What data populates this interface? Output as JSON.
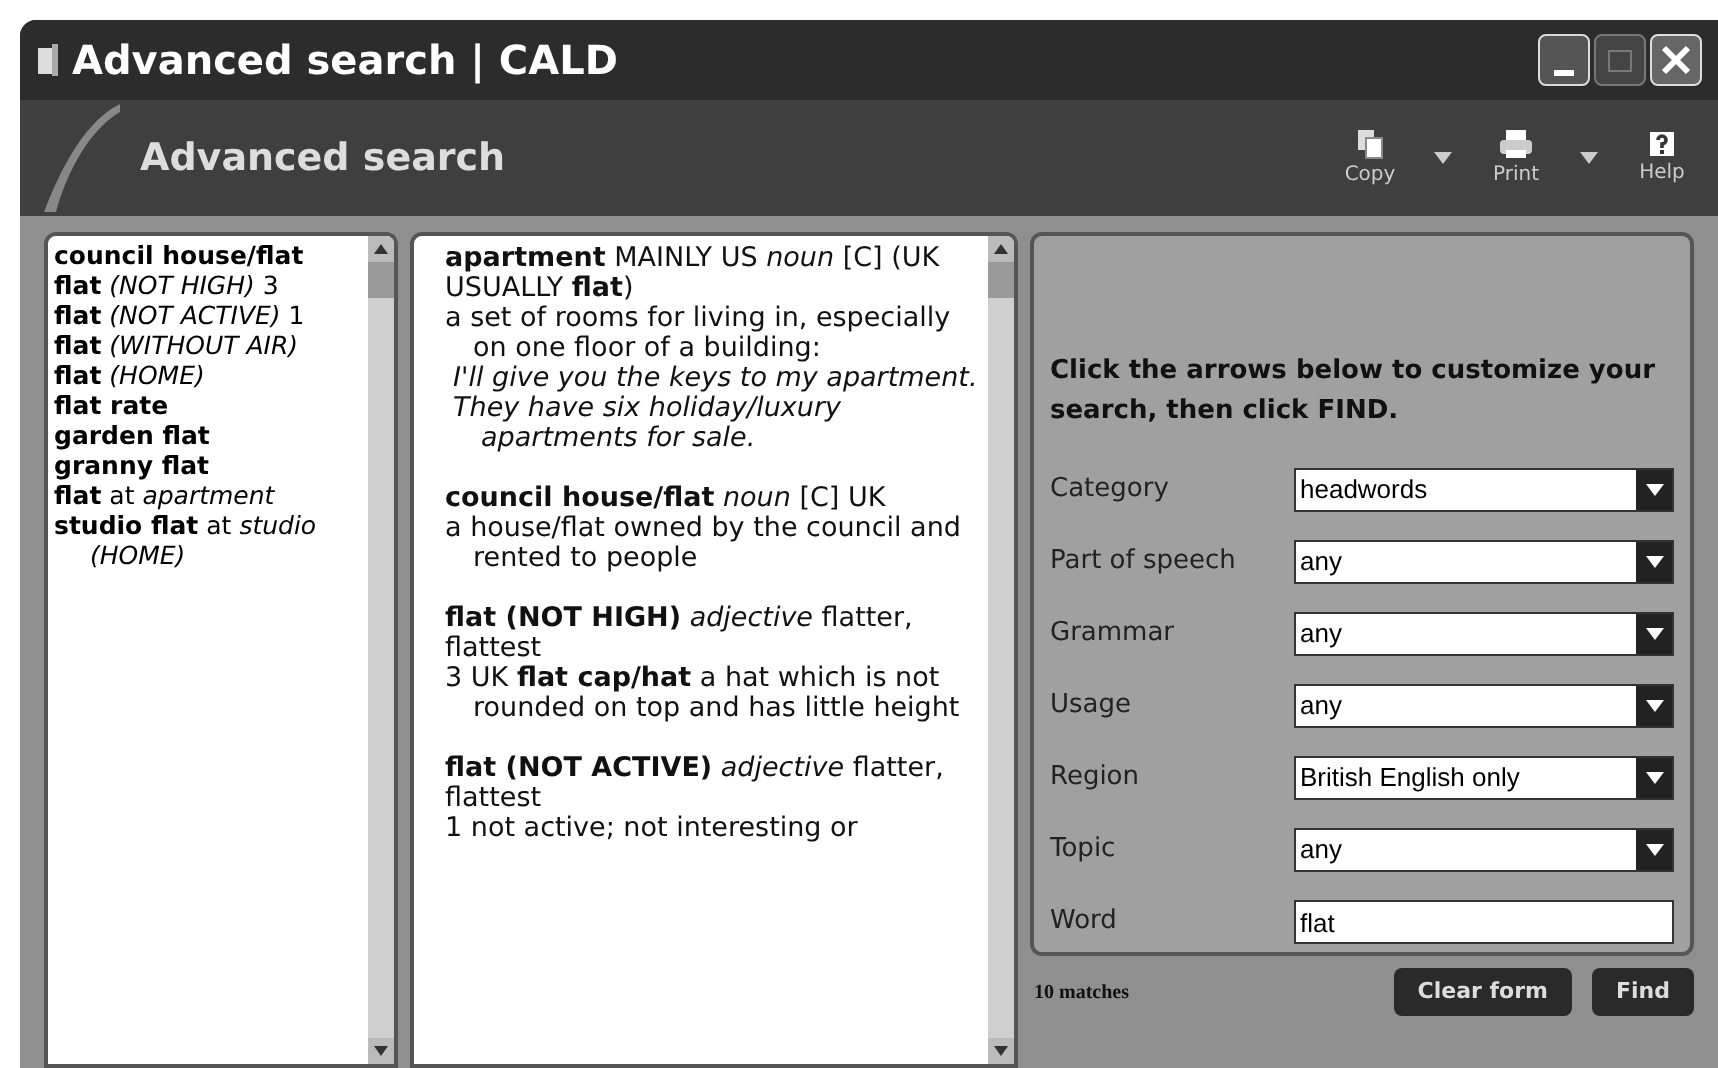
{
  "window": {
    "title": "Advanced search | CALD"
  },
  "header": {
    "title": "Advanced search"
  },
  "toolbar": [
    {
      "kind": "copy",
      "label": "Copy",
      "dropdown": true
    },
    {
      "kind": "print",
      "label": "Print",
      "dropdown": true
    },
    {
      "kind": "help",
      "label": "Help",
      "dropdown": false
    }
  ],
  "results": [
    {
      "text": "**council house/flat**",
      "selected": false
    },
    {
      "text": "**flat** *(NOT HIGH)* 3",
      "selected": false
    },
    {
      "text": "**flat** *(NOT ACTIVE)* 1",
      "selected": false
    },
    {
      "text": "**flat** *(WITHOUT AIR)*",
      "selected": false
    },
    {
      "text": "**flat** *(HOME)*",
      "selected": false
    },
    {
      "text": "**flat rate**",
      "selected": false
    },
    {
      "text": "**garden flat**",
      "selected": false
    },
    {
      "text": "**granny flat**",
      "selected": false
    },
    {
      "text": "**flat** at *apartment*",
      "selected": false
    },
    {
      "text": "**studio flat** at *studio (HOME)*",
      "selected": false
    }
  ],
  "entries": [
    {
      "headword": "**apartment** MAINLY US *noun* [C] (UK USUALLY **flat**)",
      "body": [
        {
          "kind": "definition",
          "text": "a set of rooms for living in, especially on one floor of a building:"
        },
        {
          "kind": "example",
          "text": "I'll give you the keys to my apartment."
        },
        {
          "kind": "example",
          "text": "They have six holiday/luxury apartments for sale."
        }
      ]
    },
    {
      "headword": "**council house/flat** *noun* [C] UK",
      "body": [
        {
          "kind": "definition",
          "text": "a house/flat owned by the council and rented to people"
        }
      ]
    },
    {
      "headword": "**flat (NOT HIGH)** *adjective* flatter, flattest",
      "body": [
        {
          "kind": "definition",
          "text": "3 UK **flat cap/hat** a hat which is not rounded on top and has little height"
        }
      ]
    },
    {
      "headword": "**flat (NOT ACTIVE)** *adjective* flatter, flattest",
      "body": [
        {
          "kind": "definition",
          "text": "1 not active; not interesting or"
        }
      ]
    }
  ],
  "form": {
    "instructions": "Click the arrows below to customize your search, then click FIND.",
    "fields": [
      {
        "kind": "select",
        "label": "Category",
        "value": "headwords"
      },
      {
        "kind": "select",
        "label": "Part of speech",
        "value": "any"
      },
      {
        "kind": "select",
        "label": "Grammar",
        "value": "any"
      },
      {
        "kind": "select",
        "label": "Usage",
        "value": "any"
      },
      {
        "kind": "select",
        "label": "Region",
        "value": "British English only"
      },
      {
        "kind": "select",
        "label": "Topic",
        "value": "any"
      },
      {
        "kind": "text",
        "label": "Word",
        "value": "flat"
      }
    ]
  },
  "status": {
    "matches": "10 matches"
  },
  "buttons": [
    "Clear form",
    "Find"
  ]
}
